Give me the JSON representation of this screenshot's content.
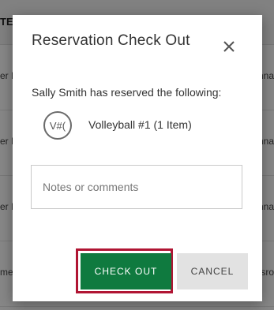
{
  "background": {
    "header_text": "TE",
    "rows": [
      {
        "left": "er B",
        "right": "nna"
      },
      {
        "left": "er B",
        "right": "nna"
      },
      {
        "left": "er B",
        "right": "nna"
      },
      {
        "left": "me",
        "right": "ssro"
      }
    ]
  },
  "modal": {
    "title": "Reservation Check Out",
    "close_icon": "close-icon",
    "subtitle": "Sally Smith has reserved the following:",
    "item": {
      "icon_text": "V#(",
      "label": "Volleyball #1 (1 Item)"
    },
    "notes": {
      "placeholder": "Notes or comments",
      "value": ""
    },
    "buttons": {
      "checkout": "CHECK OUT",
      "cancel": "CANCEL"
    },
    "colors": {
      "checkout_bg": "#0f7a3f",
      "checkout_highlight": "#b01533",
      "cancel_bg": "#e2e2e2"
    }
  }
}
